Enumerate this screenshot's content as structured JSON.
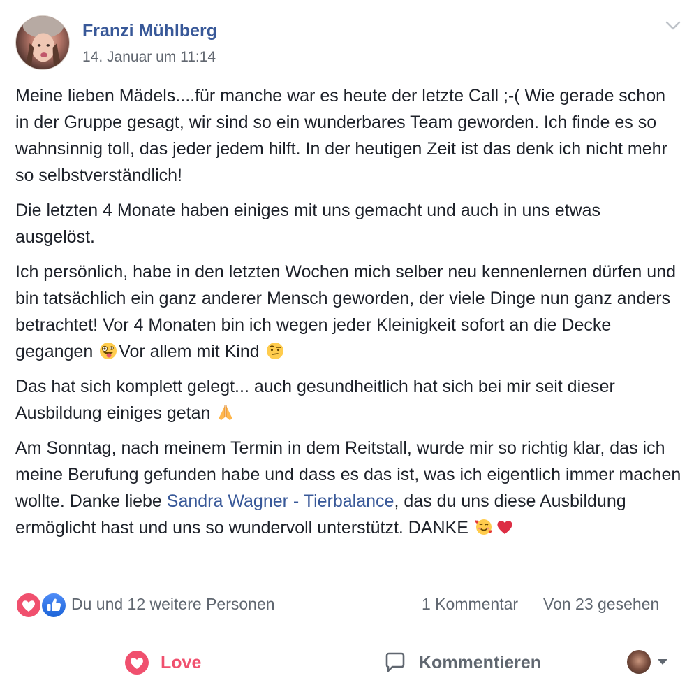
{
  "post": {
    "author": "Franzi Mühlberg",
    "timestamp": "14. Januar um 11:14",
    "paragraphs": {
      "p1": "Meine lieben Mädels....für manche war es heute der letzte Call ;-( Wie gerade schon in der Gruppe gesagt, wir sind so ein wunderbares Team geworden. Ich finde es so wahnsinnig toll, das jeder jedem hilft. In der heutigen Zeit ist das denk ich nicht mehr so selbstverständlich!",
      "p2": "Die letzten 4 Monate haben einiges mit uns gemacht und auch in uns etwas ausgelöst.",
      "p3a": "Ich persönlich, habe in den letzten Wochen mich selber neu kennenlernen dürfen und bin tatsächlich ein ganz anderer Mensch geworden, der viele Dinge nun ganz anders betrachtet! Vor 4 Monaten bin ich wegen jeder Kleinigkeit sofort an die Decke gegangen ",
      "p3b": "Vor allem mit Kind ",
      "p4": "Das hat sich komplett gelegt... auch gesundheitlich hat sich bei mir seit dieser Ausbildung einiges getan ",
      "p5a": "Am Sonntag, nach meinem Termin in dem Reitstall, wurde mir so richtig klar, das ich meine Berufung gefunden habe und dass es das ist, was ich eigentlich immer machen wollte. Danke liebe ",
      "mention": "Sandra Wagner - Tierbalance",
      "p5b": ", das du uns diese Ausbildung ermöglicht hast und uns so wundervoll unterstützt. DANKE "
    },
    "emojis": [
      "crazy-face",
      "raised-eyebrow-face",
      "folded-hands",
      "smiling-face-with-hearts",
      "red-heart"
    ]
  },
  "stats": {
    "reactions": [
      "love",
      "like"
    ],
    "reactors": "Du und 12 weitere Personen",
    "comments": "1 Kommentar",
    "seen": "Von 23 gesehen"
  },
  "actions": {
    "love_label": "Love",
    "comment_label": "Kommentieren"
  },
  "colors": {
    "link": "#385898",
    "love": "#f0506e",
    "like": "#1c64d8",
    "secondary_text": "#606770"
  }
}
